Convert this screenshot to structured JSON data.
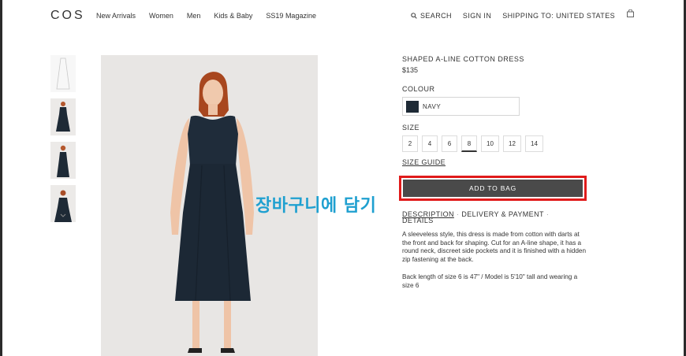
{
  "header": {
    "logo": "COS",
    "nav": [
      "New Arrivals",
      "Women",
      "Men",
      "Kids & Baby",
      "SS19 Magazine"
    ],
    "search_label": "SEARCH",
    "sign_in_label": "SIGN IN",
    "shipping_label": "SHIPPING TO:",
    "shipping_country": "UNITED STATES"
  },
  "product": {
    "title": "SHAPED A-LINE COTTON DRESS",
    "price": "$135",
    "colour_label": "COLOUR",
    "colour_value": "NAVY",
    "colour_hex": "#1e2a36",
    "size_label": "SIZE",
    "sizes": [
      "2",
      "4",
      "6",
      "8",
      "10",
      "12",
      "14"
    ],
    "selected_size": "8",
    "size_guide": "SIZE GUIDE",
    "add_to_bag": "ADD TO BAG",
    "tabs": [
      "DESCRIPTION",
      "DELIVERY & PAYMENT",
      "DETAILS"
    ],
    "description": "A sleeveless style, this dress is made from cotton with darts at the front and back for shaping. Cut for an A-line shape, it has a round neck, discreet side pockets and it is finished with a hidden zip fastening at the back.",
    "measurements": "Back length of size 6 is 47\" / Model is 5'10\" tall and wearing a size 6"
  },
  "annotation": {
    "text": "장바구니에 담기",
    "color": "#1fa0d0",
    "highlight_color": "#e01b1b"
  }
}
